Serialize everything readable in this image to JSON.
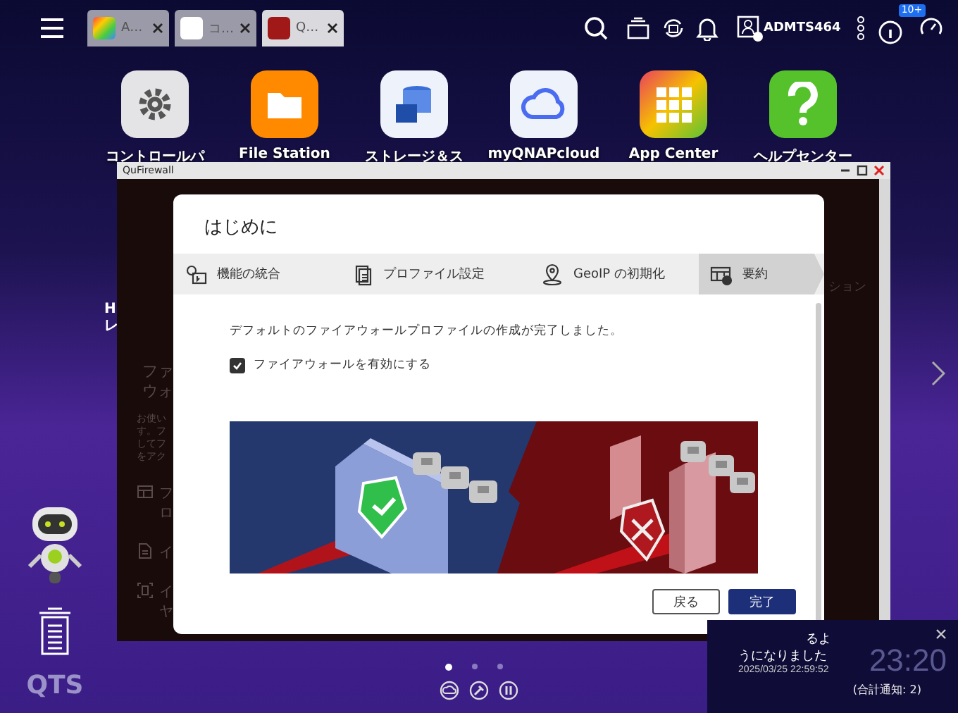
{
  "top_bar": {
    "tabs": [
      {
        "label": "A…",
        "kind": "apps",
        "selected": false
      },
      {
        "label": "コ…",
        "kind": "settings",
        "selected": false
      },
      {
        "label": "Q…",
        "kind": "firewall",
        "selected": true
      }
    ],
    "user": "ADMTS464",
    "badge": "10+"
  },
  "desktop_icons": [
    {
      "label": "コントロールパ",
      "kind": "settings"
    },
    {
      "label": "File Station",
      "kind": "folder"
    },
    {
      "label": "ストレージ＆ス",
      "kind": "storage"
    },
    {
      "label": "myQNAPcloud",
      "kind": "cloud"
    },
    {
      "label": "App Center",
      "kind": "apps"
    },
    {
      "label": "ヘルプセンター",
      "kind": "help"
    }
  ],
  "desktop_fragments": [
    "H",
    "レ"
  ],
  "window": {
    "title": "QuFirewall",
    "sidebar_texts": [
      "ファ",
      "ウォ",
      "お使い",
      "す。フ",
      "してフ",
      "をアク"
    ],
    "menu_items": [
      {
        "lines": [
          "フ",
          "ロ"
        ],
        "kind": "grid"
      },
      {
        "lines": [
          "イ"
        ],
        "kind": "doc"
      },
      {
        "lines": [
          "イ",
          "ヤ"
        ],
        "kind": "scan"
      }
    ],
    "right_text": "ション"
  },
  "dialog": {
    "title": "はじめに",
    "steps": [
      {
        "label": "機能の統合",
        "kind": "features",
        "selected": false
      },
      {
        "label": "プロファイル設定",
        "kind": "profile",
        "selected": false
      },
      {
        "label": "GeoIP の初期化",
        "kind": "geo",
        "selected": false
      },
      {
        "label": "要約",
        "kind": "summary",
        "selected": true
      }
    ],
    "message": "デフォルトのファイアウォールプロファイルの作成が完了しました。",
    "checkbox": {
      "label": "ファイアウォールを有効にする",
      "checked": true
    },
    "buttons": [
      {
        "label": "戻る",
        "kind": "secondary"
      },
      {
        "label": "完了",
        "kind": "primary"
      }
    ]
  },
  "page_dots": [
    {
      "selected": true
    },
    {
      "selected": false
    },
    {
      "selected": false
    }
  ],
  "logo": "QTS",
  "notification": {
    "line_1": "るよ",
    "line_2": "うになりました",
    "time": "2025/03/25 22:59:52",
    "clock": "23:20",
    "total": "(合計通知: 2)"
  }
}
